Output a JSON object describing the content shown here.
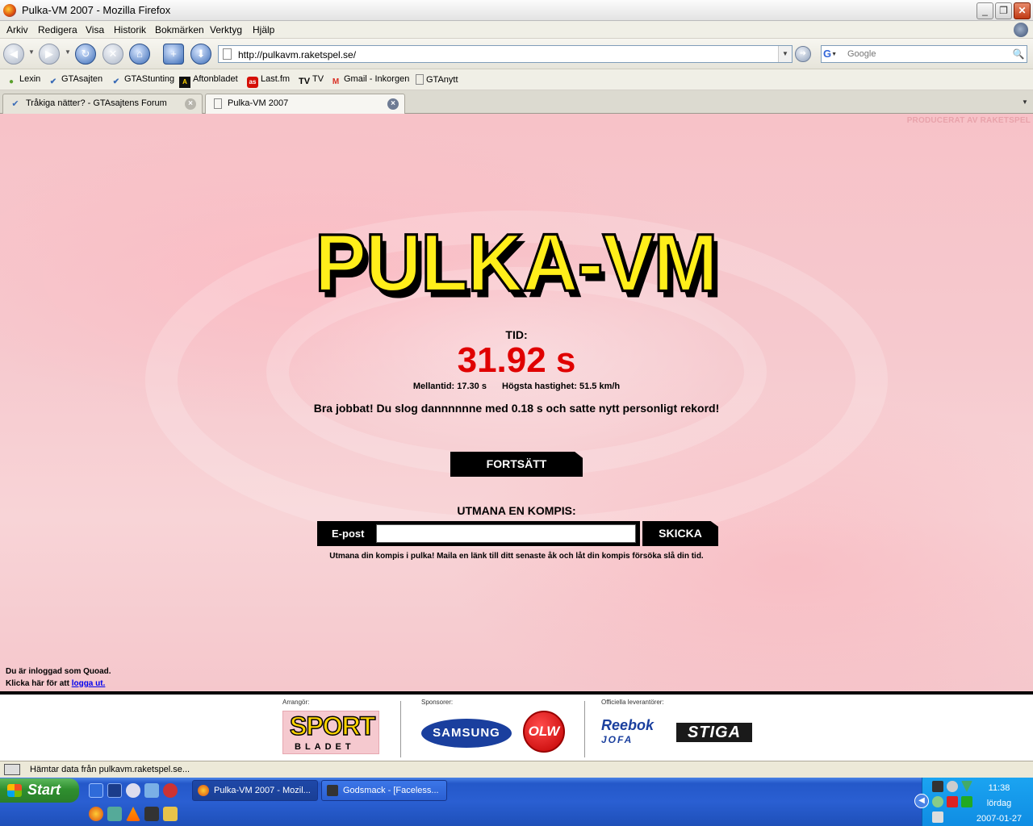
{
  "window": {
    "title": "Pulka-VM 2007 - Mozilla Firefox",
    "minimize": "_",
    "maximize": "❐",
    "close": "✕"
  },
  "menu": [
    "Arkiv",
    "Redigera",
    "Visa",
    "Historik",
    "Bokmärken",
    "Verktyg",
    "Hjälp"
  ],
  "nav": {
    "url": "http://pulkavm.raketspel.se/",
    "search_engine": "G",
    "search_placeholder": "Google"
  },
  "bookmarks": [
    {
      "label": "Lexin",
      "icon": "lexin-icon",
      "color": "#5aa02c"
    },
    {
      "label": "GTAsajten",
      "icon": "gta-icon",
      "color": "#3a6bb6"
    },
    {
      "label": "GTAStunting",
      "icon": "gta-icon",
      "color": "#3a6bb6"
    },
    {
      "label": "Aftonbladet",
      "icon": "aftonbladet-icon",
      "color": "#111111"
    },
    {
      "label": "Last.fm",
      "icon": "lastfm-icon",
      "color": "#d51007"
    },
    {
      "label": "TV",
      "icon": "tv-icon",
      "color": "#000000"
    },
    {
      "label": "Gmail - Inkorgen",
      "icon": "gmail-icon",
      "color": "#d93025"
    },
    {
      "label": "GTAnytt",
      "icon": "page-icon",
      "color": "#777777"
    }
  ],
  "tabs": [
    {
      "label": "Tråkiga nätter? - GTAsajtens Forum",
      "active": false
    },
    {
      "label": "Pulka-VM 2007",
      "active": true
    }
  ],
  "page": {
    "producer": "PRODUCERAT AV RAKETSPEL",
    "logo": "PULKA-VM",
    "time_label": "TID:",
    "time_value": "31.92 s",
    "split_time": "Mellantid: 17.30 s",
    "top_speed": "Högsta hastighet: 51.5 km/h",
    "message": "Bra jobbat! Du slog dannnnnne med 0.18 s och satte nytt personligt rekord!",
    "continue_button": "FORTSÄTT",
    "challenge_title": "UTMANA EN KOMPIS:",
    "email_label": "E-post",
    "email_value": "",
    "send_button": "SKICKA",
    "challenge_hint": "Utmana din kompis i pulka! Maila en länk till ditt senaste åk och låt din kompis försöka slå din tid.",
    "logged_in": "Du är inloggad som Quoad.",
    "logout_prefix": "Klicka här för att",
    "logout_link": "logga ut."
  },
  "footer": {
    "organizer_label": "Arrangör:",
    "sponsors_label": "Sponsorer:",
    "suppliers_label": "Officiella leverantörer:",
    "sport_logo_top": "SPORT",
    "sport_logo_bottom": "BLADET",
    "samsung": "SAMSUNG",
    "olw": "OLW",
    "reebok": "Reebok",
    "jofa": "JOFA",
    "stiga": "STIGA"
  },
  "status": "Hämtar data från pulkavm.raketspel.se...",
  "taskbar": {
    "start": "Start",
    "items": [
      {
        "label": "Pulka-VM 2007 - Mozil...",
        "active": true
      },
      {
        "label": "Godsmack - [Faceless...",
        "active": false
      }
    ],
    "clock_time": "11:38",
    "clock_day": "lördag",
    "clock_date": "2007-01-27"
  }
}
